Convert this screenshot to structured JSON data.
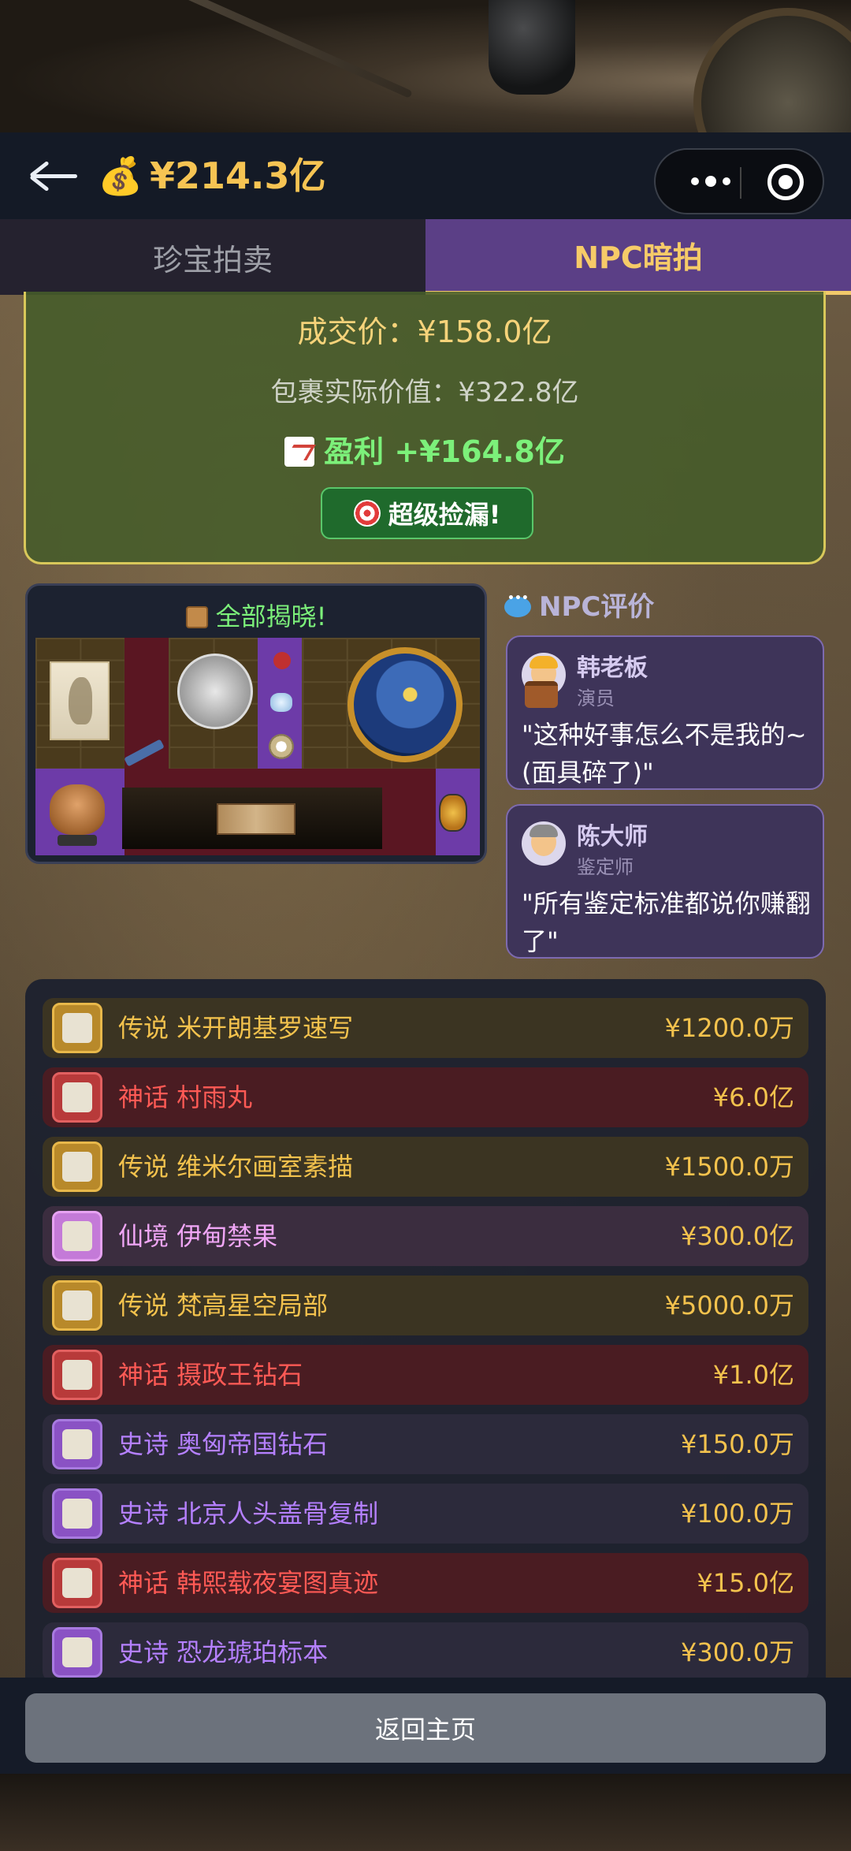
{
  "header": {
    "money": "¥214.3亿",
    "money_icon": "money-bag-icon"
  },
  "tabs": [
    {
      "label": "珍宝拍卖",
      "active": false
    },
    {
      "label": "NPC暗拍",
      "active": true
    }
  ],
  "result": {
    "deal_price": "成交价：¥158.0亿",
    "actual_value": "包裹实际价值：¥322.8亿",
    "profit": "盈利 +¥164.8亿",
    "badge": "超级捡漏!"
  },
  "reveal": {
    "title": "全部揭晓!"
  },
  "npc": {
    "title": "NPC评价",
    "comments": [
      {
        "name": "韩老板",
        "role": "演员",
        "quote": "\"这种好事怎么不是我的~(面具碎了)\""
      },
      {
        "name": "陈大师",
        "role": "鉴定师",
        "quote": "\"所有鉴定标准都说你赚翻了\""
      }
    ]
  },
  "items": [
    {
      "rarity": "legend",
      "label": "传说 米开朗基罗速写",
      "price": "¥1200.0万"
    },
    {
      "rarity": "myth",
      "label": "神话 村雨丸",
      "price": "¥6.0亿"
    },
    {
      "rarity": "legend",
      "label": "传说 维米尔画室素描",
      "price": "¥1500.0万"
    },
    {
      "rarity": "fairy",
      "label": "仙境 伊甸禁果",
      "price": "¥300.0亿"
    },
    {
      "rarity": "legend",
      "label": "传说 梵高星空局部",
      "price": "¥5000.0万"
    },
    {
      "rarity": "myth",
      "label": "神话 摄政王钻石",
      "price": "¥1.0亿"
    },
    {
      "rarity": "epic",
      "label": "史诗 奥匈帝国钻石",
      "price": "¥150.0万"
    },
    {
      "rarity": "epic",
      "label": "史诗 北京人头盖骨复制",
      "price": "¥100.0万"
    },
    {
      "rarity": "myth",
      "label": "神话 韩熙载夜宴图真迹",
      "price": "¥15.0亿"
    },
    {
      "rarity": "epic",
      "label": "史诗 恐龙琥珀标本",
      "price": "¥300.0万"
    }
  ],
  "footer": {
    "home_label": "返回主页"
  },
  "colors": {
    "legend": "#f3c24d",
    "myth": "#ff5a55",
    "fairy": "#f0a6f6",
    "epic": "#b580ff",
    "accent_gold": "#f6c453",
    "tab_active": "#5b3f86"
  }
}
